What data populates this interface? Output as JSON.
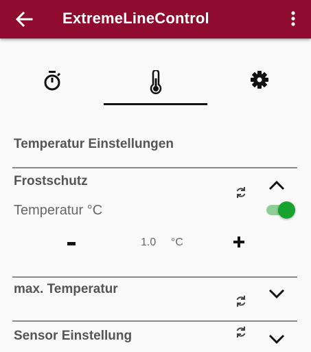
{
  "appbar": {
    "title": "ExtremeLineControl",
    "back_icon": "arrow-left-icon",
    "menu_icon": "more-vert-icon",
    "color": "#8e0a2e"
  },
  "tabs": [
    {
      "icon": "timer-icon",
      "selected": false
    },
    {
      "icon": "thermometer-icon",
      "selected": true
    },
    {
      "icon": "settings-icon",
      "selected": false
    }
  ],
  "section": {
    "title": "Temperatur Einstellungen"
  },
  "frostschutz": {
    "title": "Frostschutz",
    "expanded": true,
    "temp_label": "Temperatur °C",
    "switch_on": true,
    "value": "1.0",
    "unit": "°C",
    "minus_label": "-",
    "plus_icon": "plus-icon"
  },
  "max_temperatur": {
    "title": "max. Temperatur",
    "expanded": false
  },
  "sensor": {
    "title": "Sensor Einstellung",
    "expanded": false
  },
  "colors": {
    "accent_green": "#17a22f",
    "divider": "#8a8a8a"
  }
}
